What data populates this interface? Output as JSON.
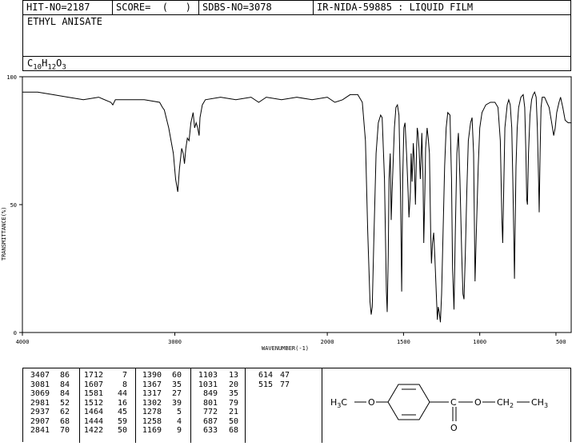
{
  "header": {
    "hit_no": "HIT-NO=2187",
    "score": "SCORE=  (   )",
    "sdbs_no": "SDBS-NO=3078",
    "ir_info": "IR-NIDA-59885 : LIQUID FILM",
    "compound_name": "ETHYL ANISATE",
    "formula": {
      "C": "C",
      "c_count": "10",
      "H": "H",
      "h_count": "12",
      "O": "O",
      "o_count": "3"
    }
  },
  "chart_data": {
    "type": "line",
    "xlabel": "WAVENUMBER(-1)",
    "ylabel": "TRANSMITTANCE(%)",
    "xlim": [
      4000,
      400
    ],
    "ylim": [
      0,
      100
    ],
    "x_ticks": [
      4000,
      3000,
      2000,
      1500,
      1000,
      500
    ],
    "y_ticks": [
      0,
      50,
      100
    ],
    "grid": false,
    "series": [
      {
        "color": "#000000",
        "points": [
          [
            4000,
            94
          ],
          [
            3900,
            94
          ],
          [
            3800,
            93
          ],
          [
            3700,
            92
          ],
          [
            3600,
            91
          ],
          [
            3500,
            92
          ],
          [
            3420,
            90
          ],
          [
            3407,
            89
          ],
          [
            3390,
            91
          ],
          [
            3300,
            91
          ],
          [
            3200,
            91
          ],
          [
            3100,
            90
          ],
          [
            3081,
            88
          ],
          [
            3069,
            87
          ],
          [
            3040,
            80
          ],
          [
            3010,
            70
          ],
          [
            2995,
            60
          ],
          [
            2981,
            55
          ],
          [
            2970,
            64
          ],
          [
            2955,
            72
          ],
          [
            2945,
            70
          ],
          [
            2937,
            66
          ],
          [
            2928,
            72
          ],
          [
            2918,
            76
          ],
          [
            2907,
            75
          ],
          [
            2895,
            82
          ],
          [
            2880,
            86
          ],
          [
            2870,
            80
          ],
          [
            2860,
            82
          ],
          [
            2850,
            80
          ],
          [
            2841,
            77
          ],
          [
            2835,
            84
          ],
          [
            2820,
            89
          ],
          [
            2800,
            91
          ],
          [
            2700,
            92
          ],
          [
            2600,
            91
          ],
          [
            2500,
            92
          ],
          [
            2450,
            90
          ],
          [
            2400,
            92
          ],
          [
            2300,
            91
          ],
          [
            2200,
            92
          ],
          [
            2100,
            91
          ],
          [
            2000,
            92
          ],
          [
            1950,
            90
          ],
          [
            1900,
            91
          ],
          [
            1850,
            93
          ],
          [
            1800,
            93
          ],
          [
            1770,
            90
          ],
          [
            1750,
            75
          ],
          [
            1735,
            40
          ],
          [
            1720,
            12
          ],
          [
            1712,
            7
          ],
          [
            1705,
            10
          ],
          [
            1695,
            35
          ],
          [
            1680,
            70
          ],
          [
            1665,
            82
          ],
          [
            1650,
            85
          ],
          [
            1640,
            84
          ],
          [
            1625,
            60
          ],
          [
            1612,
            16
          ],
          [
            1607,
            8
          ],
          [
            1600,
            30
          ],
          [
            1595,
            60
          ],
          [
            1587,
            70
          ],
          [
            1581,
            44
          ],
          [
            1575,
            55
          ],
          [
            1560,
            80
          ],
          [
            1550,
            88
          ],
          [
            1540,
            89
          ],
          [
            1530,
            85
          ],
          [
            1520,
            55
          ],
          [
            1512,
            16
          ],
          [
            1505,
            60
          ],
          [
            1498,
            80
          ],
          [
            1490,
            82
          ],
          [
            1480,
            70
          ],
          [
            1470,
            55
          ],
          [
            1464,
            45
          ],
          [
            1455,
            55
          ],
          [
            1450,
            70
          ],
          [
            1444,
            59
          ],
          [
            1436,
            74
          ],
          [
            1430,
            68
          ],
          [
            1422,
            50
          ],
          [
            1415,
            70
          ],
          [
            1410,
            80
          ],
          [
            1405,
            78
          ],
          [
            1398,
            72
          ],
          [
            1390,
            60
          ],
          [
            1385,
            68
          ],
          [
            1380,
            78
          ],
          [
            1372,
            60
          ],
          [
            1367,
            35
          ],
          [
            1360,
            55
          ],
          [
            1355,
            72
          ],
          [
            1345,
            80
          ],
          [
            1338,
            76
          ],
          [
            1330,
            70
          ],
          [
            1322,
            40
          ],
          [
            1317,
            27
          ],
          [
            1310,
            35
          ],
          [
            1302,
            39
          ],
          [
            1295,
            30
          ],
          [
            1285,
            15
          ],
          [
            1278,
            5
          ],
          [
            1272,
            10
          ],
          [
            1266,
            8
          ],
          [
            1258,
            4
          ],
          [
            1250,
            15
          ],
          [
            1240,
            40
          ],
          [
            1230,
            65
          ],
          [
            1220,
            80
          ],
          [
            1210,
            86
          ],
          [
            1195,
            85
          ],
          [
            1185,
            60
          ],
          [
            1178,
            25
          ],
          [
            1169,
            9
          ],
          [
            1160,
            40
          ],
          [
            1150,
            70
          ],
          [
            1140,
            78
          ],
          [
            1130,
            60
          ],
          [
            1118,
            30
          ],
          [
            1110,
            15
          ],
          [
            1103,
            13
          ],
          [
            1095,
            30
          ],
          [
            1085,
            55
          ],
          [
            1075,
            75
          ],
          [
            1060,
            82
          ],
          [
            1050,
            84
          ],
          [
            1040,
            70
          ],
          [
            1031,
            20
          ],
          [
            1022,
            40
          ],
          [
            1010,
            65
          ],
          [
            1000,
            80
          ],
          [
            985,
            86
          ],
          [
            960,
            89
          ],
          [
            930,
            90
          ],
          [
            900,
            90
          ],
          [
            880,
            88
          ],
          [
            865,
            75
          ],
          [
            855,
            45
          ],
          [
            849,
            35
          ],
          [
            843,
            55
          ],
          [
            835,
            80
          ],
          [
            820,
            89
          ],
          [
            810,
            91
          ],
          [
            800,
            89
          ],
          [
            790,
            80
          ],
          [
            783,
            60
          ],
          [
            776,
            35
          ],
          [
            772,
            21
          ],
          [
            768,
            40
          ],
          [
            762,
            65
          ],
          [
            754,
            80
          ],
          [
            745,
            88
          ],
          [
            730,
            92
          ],
          [
            715,
            93
          ],
          [
            705,
            88
          ],
          [
            697,
            70
          ],
          [
            692,
            52
          ],
          [
            687,
            50
          ],
          [
            680,
            70
          ],
          [
            670,
            85
          ],
          [
            660,
            91
          ],
          [
            650,
            93
          ],
          [
            640,
            94
          ],
          [
            630,
            92
          ],
          [
            622,
            80
          ],
          [
            614,
            60
          ],
          [
            610,
            47
          ],
          [
            604,
            70
          ],
          [
            598,
            88
          ],
          [
            590,
            92
          ],
          [
            575,
            92
          ],
          [
            560,
            90
          ],
          [
            545,
            88
          ],
          [
            528,
            82
          ],
          [
            515,
            77
          ],
          [
            505,
            80
          ],
          [
            495,
            86
          ],
          [
            480,
            90
          ],
          [
            470,
            92
          ],
          [
            455,
            88
          ],
          [
            440,
            83
          ],
          [
            420,
            82
          ],
          [
            400,
            82
          ]
        ]
      }
    ]
  },
  "peaks": {
    "columns": [
      [
        [
          "3407",
          "86"
        ],
        [
          "3081",
          "84"
        ],
        [
          "3069",
          "84"
        ],
        [
          "2981",
          "52"
        ],
        [
          "2937",
          "62"
        ],
        [
          "2907",
          "68"
        ],
        [
          "2841",
          "70"
        ]
      ],
      [
        [
          "1712",
          "7"
        ],
        [
          "1607",
          "8"
        ],
        [
          "1581",
          "44"
        ],
        [
          "1512",
          "16"
        ],
        [
          "1464",
          "45"
        ],
        [
          "1444",
          "59"
        ],
        [
          "1422",
          "50"
        ]
      ],
      [
        [
          "1390",
          "60"
        ],
        [
          "1367",
          "35"
        ],
        [
          "1317",
          "27"
        ],
        [
          "1302",
          "39"
        ],
        [
          "1278",
          "5"
        ],
        [
          "1258",
          "4"
        ],
        [
          "1169",
          "9"
        ]
      ],
      [
        [
          "1103",
          "13"
        ],
        [
          "1031",
          "20"
        ],
        [
          "849",
          "35"
        ],
        [
          "801",
          "79"
        ],
        [
          "772",
          "21"
        ],
        [
          "687",
          "50"
        ],
        [
          "633",
          "68"
        ]
      ],
      [
        [
          "614",
          "47"
        ],
        [
          "515",
          "77"
        ]
      ]
    ]
  },
  "structure": {
    "ch3_left": {
      "H": "H",
      "n": "3",
      "C": "C"
    },
    "o1": "O",
    "c_carbonyl": "C",
    "o_double": "O",
    "o2": "O",
    "ch2": {
      "C": "CH",
      "n": "2"
    },
    "ch3_right": {
      "C": "CH",
      "n": "3"
    }
  }
}
